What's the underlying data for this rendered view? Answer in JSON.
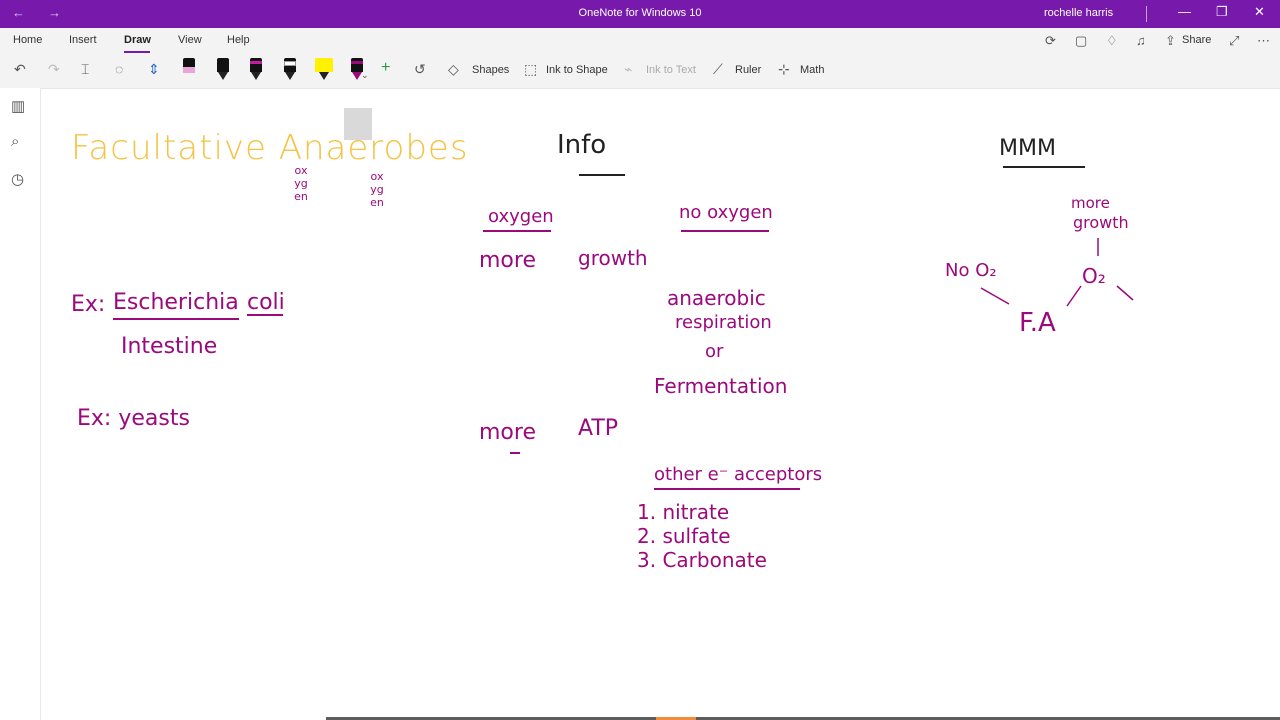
{
  "window": {
    "title": "OneNote for Windows 10",
    "user": "rochelle harris",
    "controls": {
      "back_icon": "←",
      "forward_icon": "→",
      "minimize_icon": "—",
      "restore_icon": "❐",
      "close_icon": "✕"
    }
  },
  "menu": {
    "tabs": [
      {
        "label": "Home"
      },
      {
        "label": "Insert"
      },
      {
        "label": "Draw"
      },
      {
        "label": "View"
      },
      {
        "label": "Help"
      }
    ],
    "active_tab": "Draw",
    "share_label": "Share"
  },
  "toolbar": {
    "shapes_label": "Shapes",
    "ink_to_shape_label": "Ink to Shape",
    "ink_to_text_label": "Ink to Text",
    "ruler_label": "Ruler",
    "math_label": "Math",
    "pens": [
      {
        "name": "pen-pink",
        "color": "#e7a6d5"
      },
      {
        "name": "pen-black",
        "color": "#111111"
      },
      {
        "name": "pen-black-magenta",
        "color": "#c21ba0"
      },
      {
        "name": "pen-black-white",
        "color": "#ffffff"
      },
      {
        "name": "highlighter-yellow",
        "color": "#fff200"
      },
      {
        "name": "pen-magenta-selected",
        "color": "#9b0a7c"
      }
    ]
  },
  "colors": {
    "accent": "#7719aa",
    "ink_purple": "#9b0a7c",
    "ink_yellow": "#f5c242"
  },
  "notes": {
    "title": "Facultative Anaerobes",
    "oxygen_vertical": "oxygen",
    "oxygen_vertical2": "oxygen",
    "example1_prefix": "Ex:",
    "example1_name": "Escherichia",
    "example1_name2": "coli",
    "example1_location": "Intestine",
    "example2": "Ex: yeasts",
    "info_heading": "Info",
    "oxygen_heading": "oxygen",
    "more": "more",
    "growth": "growth",
    "no_oxygen_heading": "no oxygen",
    "anaerobic": "anaerobic",
    "respiration": "respiration",
    "or": "or",
    "fermentation": "Fermentation",
    "more_atp_1": "more",
    "more_atp_2": "ATP",
    "other_acceptors": "other e⁻ acceptors",
    "acceptors": [
      "1. nitrate",
      "2. sulfate",
      "3. Carbonate"
    ],
    "mmm": "MMM",
    "more_growth_1": "more",
    "more_growth_2": "growth",
    "no_o2": "No O₂",
    "o2": "O₂",
    "fa": "F.A"
  }
}
